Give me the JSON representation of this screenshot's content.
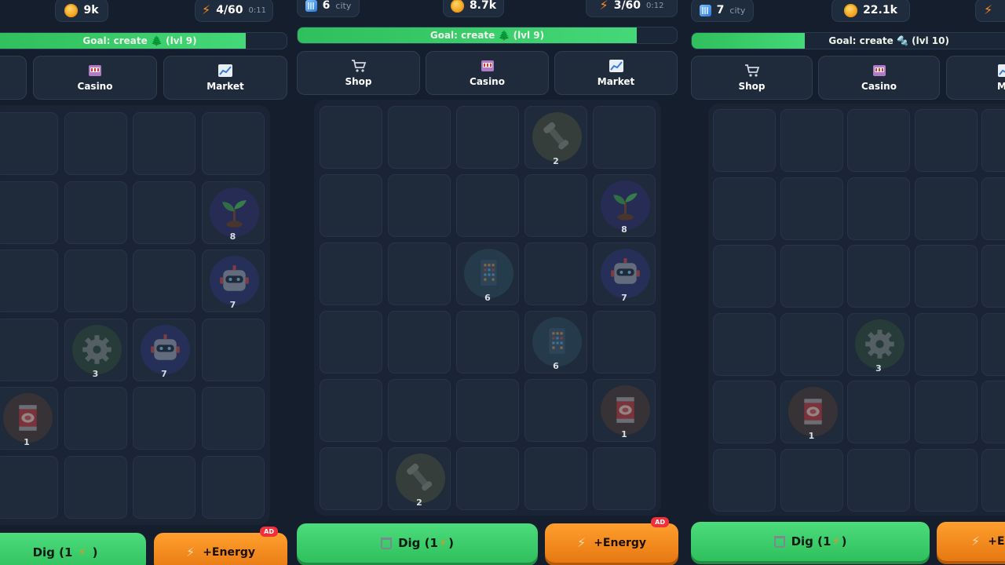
{
  "panels": [
    {
      "city": {
        "count": "",
        "label": ""
      },
      "coins": "9k",
      "energy": {
        "value": "4/60",
        "timer": "0:11"
      },
      "goal": {
        "text": "Goal: create 🌲 (lvl 9)",
        "progress": 0.85
      },
      "nav": [
        {
          "label": "",
          "icon": "cart-icon"
        },
        {
          "label": "Casino",
          "icon": "slot-machine-icon"
        },
        {
          "label": "Market",
          "icon": "chart-icon"
        }
      ],
      "cells": [
        {
          "row": 1,
          "col": 4,
          "icon": "sprout-icon",
          "level": "8"
        },
        {
          "row": 2,
          "col": 4,
          "icon": "robot-icon",
          "level": "7"
        },
        {
          "row": 3,
          "col": 2,
          "icon": "gear-icon",
          "level": "3"
        },
        {
          "row": 3,
          "col": 3,
          "icon": "robot-icon",
          "level": "7"
        },
        {
          "row": 4,
          "col": 1,
          "icon": "can-icon",
          "level": "1"
        }
      ],
      "dig_label": "Dig (1",
      "dig_suffix": ")",
      "energy_label": "+Energy",
      "ad_badge": "AD"
    },
    {
      "city": {
        "count": "6",
        "label": "city"
      },
      "coins": "8.7k",
      "energy": {
        "value": "3/60",
        "timer": "0:12"
      },
      "goal": {
        "text": "Goal: create 🌲 (lvl 9)",
        "progress": 0.9
      },
      "nav": [
        {
          "label": "Shop",
          "icon": "cart-icon"
        },
        {
          "label": "Casino",
          "icon": "slot-machine-icon"
        },
        {
          "label": "Market",
          "icon": "chart-icon"
        }
      ],
      "cells": [
        {
          "row": 0,
          "col": 3,
          "icon": "wrench-icon",
          "level": "2"
        },
        {
          "row": 1,
          "col": 4,
          "icon": "sprout-icon",
          "level": "8"
        },
        {
          "row": 2,
          "col": 2,
          "icon": "building-icon",
          "level": "6"
        },
        {
          "row": 2,
          "col": 4,
          "icon": "robot-icon",
          "level": "7"
        },
        {
          "row": 3,
          "col": 3,
          "icon": "building-icon",
          "level": "6"
        },
        {
          "row": 4,
          "col": 4,
          "icon": "can-icon",
          "level": "1"
        },
        {
          "row": 5,
          "col": 1,
          "icon": "wrench-icon",
          "level": "2"
        }
      ],
      "dig_label": "Dig (1",
      "dig_suffix": ")",
      "energy_label": "+Energy",
      "ad_badge": "AD"
    },
    {
      "city": {
        "count": "7",
        "label": "city"
      },
      "coins": "22.1k",
      "energy": {
        "value": "",
        "timer": ""
      },
      "goal": {
        "text": "Goal: create 🔩 (lvl 10)",
        "progress": 0.36
      },
      "nav": [
        {
          "label": "Shop",
          "icon": "cart-icon"
        },
        {
          "label": "Casino",
          "icon": "slot-machine-icon"
        },
        {
          "label": "Ma",
          "icon": "chart-icon"
        }
      ],
      "cells": [
        {
          "row": 3,
          "col": 2,
          "icon": "gear-icon",
          "level": "3"
        },
        {
          "row": 4,
          "col": 1,
          "icon": "can-icon",
          "level": "1"
        }
      ],
      "dig_label": "Dig (1",
      "dig_suffix": ")",
      "energy_label": "+E",
      "ad_badge": ""
    }
  ],
  "colors": {
    "green": "#3ccf6a",
    "orange": "#f28c1e",
    "bg": "#141e2d"
  }
}
